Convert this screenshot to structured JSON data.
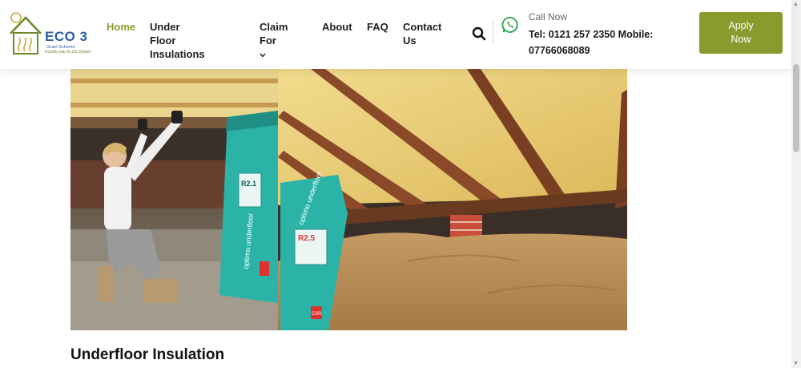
{
  "brand": {
    "name": "ECO 3",
    "subtitle": "Grant Scheme",
    "tagline": "Funds you to Go Green"
  },
  "nav": {
    "home": "Home",
    "underfloor_line1": "Under Floor",
    "underfloor_line2": "Insulations",
    "claim": "Claim For",
    "about": "About",
    "faq": "FAQ",
    "contact_line1": "Contact",
    "contact_line2": "Us"
  },
  "contact": {
    "call_label": "Call Now",
    "phone_line1": "Tel: 0121 257 2350 Mobile:",
    "phone_line2": "07766068089"
  },
  "cta": {
    "line1": "Apply",
    "line2": "Now"
  },
  "hero": {
    "bag_label": "optimo underfloor",
    "bag_rating_left": "R2.1",
    "bag_rating_right": "R2.5",
    "bag_brand": "CSR"
  },
  "page": {
    "heading": "Underfloor Insulation"
  },
  "colors": {
    "accent": "#8a9a2c",
    "logo_blue": "#2a5fa0",
    "bag_teal": "#2bb3a8",
    "insulation_yellow": "#e8cf7a",
    "joist_brown": "#8a4a2a",
    "soil": "#b98a55"
  },
  "icons": {
    "search": "search-icon",
    "whatsapp": "whatsapp-icon",
    "chevron": "chevron-down-icon"
  }
}
